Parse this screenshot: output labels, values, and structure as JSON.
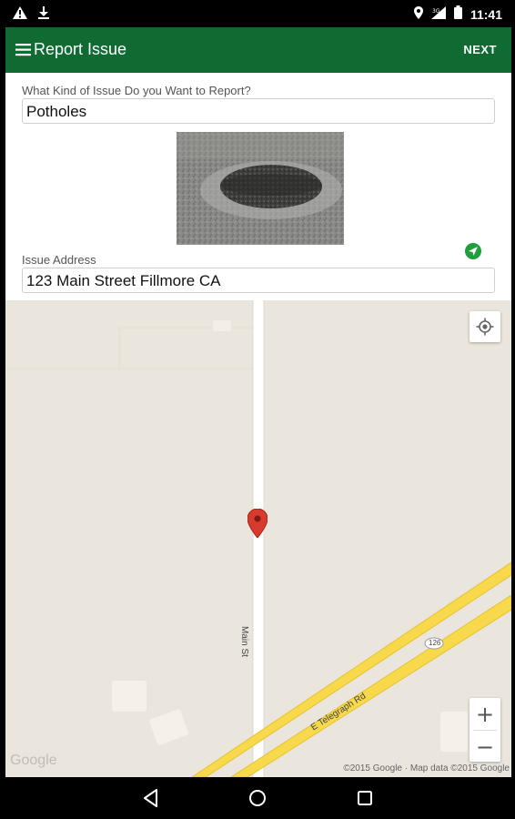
{
  "status_bar": {
    "time": "11:41",
    "icons": [
      "warning-icon",
      "download-icon",
      "location-pin-icon",
      "signal-icon",
      "battery-icon"
    ]
  },
  "toolbar": {
    "title": "Report Issue",
    "next_label": "NEXT",
    "color": "#106b33"
  },
  "form": {
    "issue_type_label": "What Kind of Issue Do you Want to Report?",
    "issue_type_value": "Potholes",
    "address_label": "Issue Address",
    "address_value": "123 Main Street Fillmore CA"
  },
  "map": {
    "streets": {
      "main": "Main St",
      "telegraph": "E Telegraph Rd",
      "route_shield": "126"
    },
    "attribution": "©2015 Google · Map data ©2015 Google",
    "logo": "Google",
    "zoom_in": "+",
    "zoom_out": "−"
  },
  "navbar": {
    "icons": [
      "back-icon",
      "home-icon",
      "recents-icon"
    ]
  }
}
